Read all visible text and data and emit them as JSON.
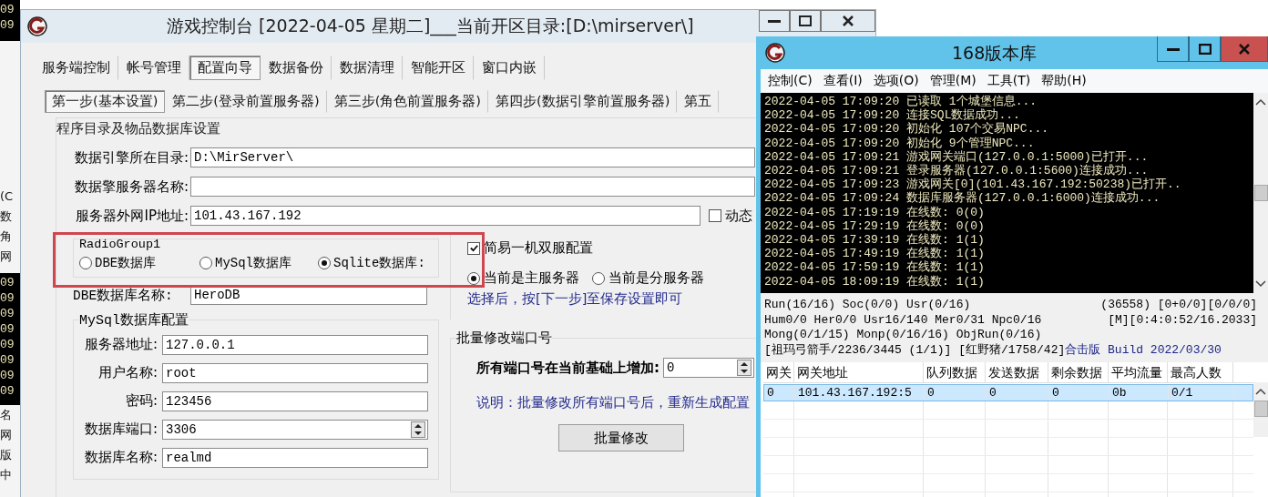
{
  "background_strip": {
    "segments": [
      {
        "kind": "dark",
        "texts": [
          "09",
          "09"
        ]
      },
      {
        "kind": "light"
      },
      {
        "kind": "light",
        "texts": [
          "(C",
          "数",
          "角",
          "网"
        ]
      },
      {
        "kind": "dark",
        "texts": [
          "09",
          "09",
          "09",
          "09",
          "09",
          "09",
          "09",
          "09"
        ]
      },
      {
        "kind": "light",
        "texts": [
          "名",
          "网",
          "版",
          "中"
        ]
      }
    ]
  },
  "config_window": {
    "title": "游戏控制台 [2022-04-05 星期二]___当前开区目录:[D:\\mirserver\\]",
    "tabs": [
      {
        "label": "服务端控制",
        "selected": false
      },
      {
        "label": "帐号管理",
        "selected": false
      },
      {
        "label": "配置向导",
        "selected": true
      },
      {
        "label": "数据备份",
        "selected": false
      },
      {
        "label": "数据清理",
        "selected": false
      },
      {
        "label": "智能开区",
        "selected": false
      },
      {
        "label": "窗口内嵌",
        "selected": false
      }
    ],
    "steps": [
      {
        "label": "第一步(基本设置)",
        "selected": true
      },
      {
        "label": "第二步(登录前置服务器)",
        "selected": false
      },
      {
        "label": "第三步(角色前置服务器)",
        "selected": false
      },
      {
        "label": "第四步(数据引擎前置服务器)",
        "selected": false
      },
      {
        "label": "第五",
        "selected": false
      }
    ],
    "group_title": "程序目录及物品数据库设置",
    "paths": [
      {
        "label": "数据引擎所在目录:",
        "value": "D:\\MirServer\\"
      },
      {
        "label": "数据擎服务器名称:"
      },
      {
        "label": "服务器外网IP地址:",
        "value": "101.43.167.192"
      }
    ],
    "dynamic_checkbox": {
      "label": "动态",
      "checked": false
    },
    "db_type": {
      "title": "RadioGroup1",
      "highlighted": true,
      "options": [
        {
          "label": "DBE数据库",
          "selected": false
        },
        {
          "label": "MySql数据库",
          "selected": false
        },
        {
          "label": "Sqlite数据库:",
          "selected": true
        }
      ]
    },
    "dbe_name": {
      "label": "DBE数据库名称:",
      "value": "HeroDB"
    },
    "mysql": {
      "title": "MySql数据库配置",
      "fields": [
        {
          "label": "服务器地址:",
          "value": "127.0.0.1",
          "kind": "text"
        },
        {
          "label": "用户名称:",
          "value": "root",
          "kind": "text"
        },
        {
          "label": "密码:",
          "value": "123456",
          "kind": "text"
        },
        {
          "label": "数据库端口:",
          "value": "3306",
          "kind": "spin"
        },
        {
          "label": "数据库名称:",
          "value": "realmd",
          "kind": "text"
        }
      ]
    },
    "dual_server": {
      "checkbox": {
        "label": "简易一机双服配置",
        "checked": true
      },
      "roles": [
        {
          "label": "当前是主服务器",
          "selected": true
        },
        {
          "label": "当前是分服务器",
          "selected": false
        }
      ],
      "hint": "选择后，按[下一步]至保存设置即可"
    },
    "port_batch": {
      "title": "批量修改端口号",
      "label": "所有端口号在当前基础上增加:",
      "value": "0",
      "note": "说明：批量修改所有端口号后，重新生成配置",
      "button": "批量修改"
    }
  },
  "server_window": {
    "title": "168版本库",
    "menu": [
      "控制(C)",
      "查看(I)",
      "选项(O)",
      "管理(M)",
      "工具(T)",
      "帮助(H)"
    ],
    "log": [
      {
        "time": "2022-04-05 17:09:20",
        "message": "已读取 1个城堡信息..."
      },
      {
        "time": "2022-04-05 17:09:20",
        "message": "连接SQL数据成功..."
      },
      {
        "time": "2022-04-05 17:09:20",
        "message": "初始化 107个交易NPC..."
      },
      {
        "time": "2022-04-05 17:09:20",
        "message": "初始化 9个管理NPC..."
      },
      {
        "time": "2022-04-05 17:09:21",
        "message": "游戏网关端口(127.0.0.1:5000)已打开..."
      },
      {
        "time": "2022-04-05 17:09:21",
        "message": "登录服务器(127.0.0.1:5600)连接成功..."
      },
      {
        "time": "2022-04-05 17:09:23",
        "message": "游戏网关[0](101.43.167.192:50238)已打开.."
      },
      {
        "time": "2022-04-05 17:09:24",
        "message": "数据库服务器(127.0.0.1:6000)连接成功..."
      },
      {
        "time": "2022-04-05 17:19:19",
        "message": "在线数: 0(0)"
      },
      {
        "time": "2022-04-05 17:29:19",
        "message": "在线数: 0(0)"
      },
      {
        "time": "2022-04-05 17:39:19",
        "message": "在线数: 1(1)"
      },
      {
        "time": "2022-04-05 17:49:19",
        "message": "在线数: 1(1)"
      },
      {
        "time": "2022-04-05 17:59:19",
        "message": "在线数: 1(1)"
      },
      {
        "time": "2022-04-05 18:09:19",
        "message": "在线数: 1(1)"
      }
    ],
    "status": [
      {
        "left": "Run(16/16) Soc(0/0) Usr(0/16)",
        "right": "(36558) [0+0/0][0/0/0]"
      },
      {
        "left": "Hum0/0 Her0/0 Usr16/140 Mer0/31 Npc0/16",
        "right": "[M][0:4:0:52/16.2033]"
      },
      {
        "left": "Mong(0/1/15) Monp(0/16/16) ObjRun(0/16)"
      },
      {
        "left": "[祖玛弓箭手/2236/3445 (1/1)]  [红野猪/1758/42]",
        "build": "合击版 Build 2022/03/30"
      }
    ],
    "table": {
      "columns": [
        "网关",
        "网关地址",
        "队列数据",
        "发送数据",
        "剩余数据",
        "平均流量",
        "最高人数"
      ],
      "rows": [
        {
          "cells": [
            "0",
            "101.43.167.192:5",
            "0",
            "0",
            "0",
            "0b",
            "0/1"
          ],
          "selected": true
        }
      ]
    }
  }
}
